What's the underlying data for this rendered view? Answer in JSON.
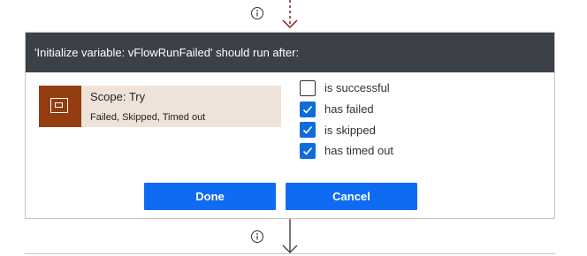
{
  "dialog": {
    "title": "'Initialize variable: vFlowRunFailed' should run after:"
  },
  "action": {
    "title": "Scope: Try",
    "statuses": "Failed, Skipped, Timed out",
    "icon": "scope-icon",
    "color": "#933d11"
  },
  "conditions": [
    {
      "label": "is successful",
      "checked": false
    },
    {
      "label": "has failed",
      "checked": true
    },
    {
      "label": "is skipped",
      "checked": true
    },
    {
      "label": "has timed out",
      "checked": true
    }
  ],
  "buttons": {
    "done": "Done",
    "cancel": "Cancel"
  },
  "colors": {
    "header": "#3c4148",
    "primary": "#0f6cf2",
    "checkbox": "#0f6cdb",
    "arrow_top": "#8b1a1a",
    "arrow_bottom": "#4a4a4a"
  },
  "icons": {
    "info_top": "info-icon",
    "info_bottom": "info-icon",
    "arrow_top": "dashed-arrow-down-icon",
    "arrow_bottom": "arrow-down-icon"
  }
}
